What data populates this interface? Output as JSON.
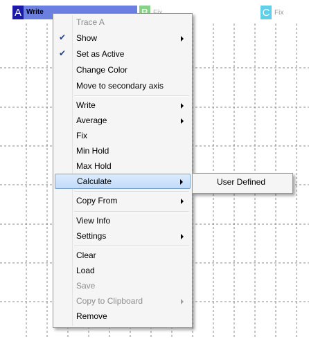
{
  "traces": {
    "a": {
      "letter": "A",
      "label": "Write"
    },
    "b": {
      "letter": "B",
      "label": "Fix"
    },
    "c": {
      "letter": "C",
      "label": "Fix"
    }
  },
  "context_menu": {
    "header": "Trace A",
    "items": [
      {
        "label": "Show",
        "checked": true,
        "submenu": true
      },
      {
        "label": "Set as Active",
        "checked": true
      },
      {
        "label": "Change Color"
      },
      {
        "label": "Move to secondary axis"
      },
      {
        "label": "Write",
        "submenu": true
      },
      {
        "label": "Average",
        "submenu": true
      },
      {
        "label": "Fix"
      },
      {
        "label": "Min Hold"
      },
      {
        "label": "Max Hold"
      },
      {
        "label": "Calculate",
        "submenu": true,
        "highlighted": true
      },
      {
        "label": "Copy From",
        "submenu": true
      },
      {
        "label": "View Info"
      },
      {
        "label": "Settings",
        "submenu": true
      },
      {
        "label": "Clear"
      },
      {
        "label": "Load"
      },
      {
        "label": "Save",
        "disabled": true
      },
      {
        "label": "Copy to Clipboard",
        "disabled": true,
        "submenu": true
      },
      {
        "label": "Remove"
      }
    ]
  },
  "calculate_submenu": {
    "items": [
      {
        "label": "User Defined"
      }
    ]
  },
  "colors": {
    "trace_a": "#1a1aa6",
    "trace_b": "#8ad08a",
    "trace_c": "#5fd0e8",
    "highlight": "#c1dbfa"
  }
}
